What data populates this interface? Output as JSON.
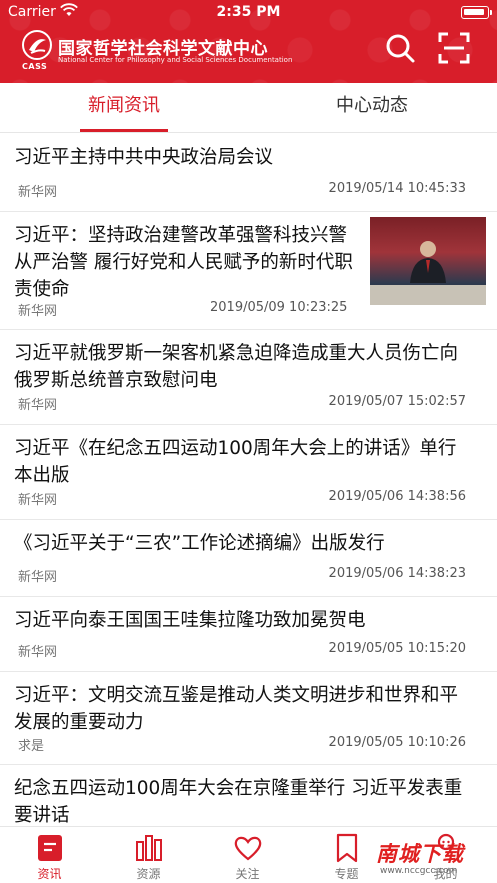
{
  "status_bar": {
    "carrier": "Carrier",
    "time": "2:35 PM"
  },
  "brand": {
    "logo_text": "CASS",
    "title": "国家哲学社会科学文献中心",
    "subtitle": "National Center for Philosophy and Social Sciences Documentation",
    "color": "#d81e2a"
  },
  "header_actions": {
    "search_icon": "search-icon",
    "scan_icon": "scan-icon"
  },
  "tabs": [
    {
      "label": "新闻资讯",
      "active": true
    },
    {
      "label": "中心动态",
      "active": false
    }
  ],
  "news": [
    {
      "title": "习近平主持中共中央政治局会议",
      "source": "新华网",
      "time": "2019/05/14 10:45:33"
    },
    {
      "title": "习近平：坚持政治建警改革强警科技兴警从严治警 履行好党和人民赋予的新时代职责使命",
      "source": "新华网",
      "time": "2019/05/09 10:23:25",
      "has_image": true
    },
    {
      "title": "习近平就俄罗斯一架客机紧急迫降造成重大人员伤亡向俄罗斯总统普京致慰问电",
      "source": "新华网",
      "time": "2019/05/07 15:02:57"
    },
    {
      "title": "习近平《在纪念五四运动100周年大会上的讲话》单行本出版",
      "source": "新华网",
      "time": "2019/05/06 14:38:56"
    },
    {
      "title": "《习近平关于“三农”工作论述摘编》出版发行",
      "source": "新华网",
      "time": "2019/05/06 14:38:23"
    },
    {
      "title": "习近平向泰王国国王哇集拉隆功致加冕贺电",
      "source": "新华网",
      "time": "2019/05/05 10:15:20"
    },
    {
      "title": "习近平：文明交流互鉴是推动人类文明进步和世界和平发展的重要动力",
      "source": "求是",
      "time": "2019/05/05 10:10:26"
    },
    {
      "title": "纪念五四运动100周年大会在京隆重举行 习近平发表重要讲话",
      "source": "",
      "time": ""
    }
  ],
  "tabbar": [
    {
      "label": "资讯",
      "icon": "news-icon",
      "active": true
    },
    {
      "label": "资源",
      "icon": "books-icon",
      "active": false
    },
    {
      "label": "关注",
      "icon": "heart-icon",
      "active": false
    },
    {
      "label": "专题",
      "icon": "bookmark-icon",
      "active": false
    },
    {
      "label": "我的",
      "icon": "user-icon",
      "active": false
    }
  ],
  "watermark": {
    "text": "南城下载",
    "url": "www.nccgcc.com"
  }
}
